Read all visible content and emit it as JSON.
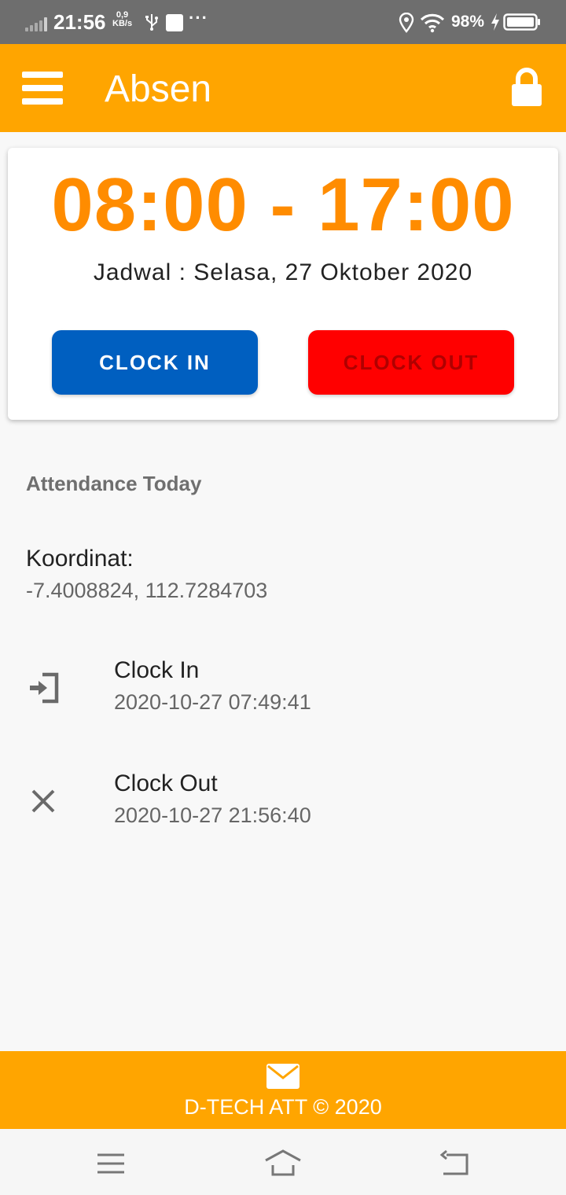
{
  "status_bar": {
    "time": "21:56",
    "net_speed_value": "0,9",
    "net_speed_unit": "KB/s",
    "more": "···",
    "battery": "98%"
  },
  "app_bar": {
    "title": "Absen",
    "menu_icon": "hamburger-menu-icon",
    "action_icon": "lock-icon"
  },
  "schedule": {
    "hours": "08:00 - 17:00",
    "date_text": "Jadwal : Selasa, 27 Oktober 2020",
    "clock_in_label": "CLOCK IN",
    "clock_out_label": "CLOCK OUT"
  },
  "attendance": {
    "title": "Attendance Today",
    "coord_label": "Koordinat:",
    "coord_value": "-7.4008824, 112.7284703",
    "items": [
      {
        "icon": "sign-in-icon",
        "label": "Clock In",
        "time": "2020-10-27 07:49:41"
      },
      {
        "icon": "close-icon",
        "label": "Clock Out",
        "time": "2020-10-27 21:56:40"
      }
    ]
  },
  "footer": {
    "icon": "envelope-icon",
    "text": "D-TECH ATT © 2020"
  },
  "colors": {
    "primary": "#ffa500",
    "shift_time": "#ff8c00",
    "clock_in_button": "#005fc0",
    "clock_out_button": "#ff0000"
  }
}
